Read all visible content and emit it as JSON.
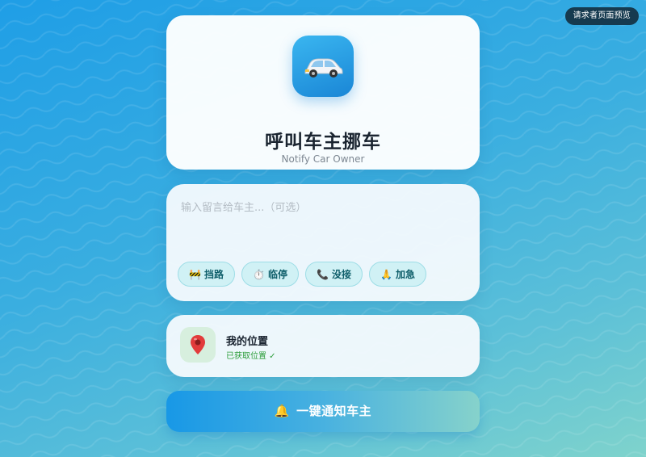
{
  "preview_button": {
    "label": "请求者页面预览"
  },
  "header": {
    "app_icon": "car-icon",
    "title": "呼叫车主挪车",
    "subtitle": "Notify Car Owner"
  },
  "message": {
    "placeholder": "输入留言给车主...（可选）",
    "value": "",
    "quick_chips": [
      {
        "icon": "roadblock-icon",
        "glyph": "🚧",
        "label": "挡路"
      },
      {
        "icon": "stopwatch-icon",
        "glyph": "⏱️",
        "label": "临停"
      },
      {
        "icon": "phone-icon",
        "glyph": "📞",
        "label": "没接"
      },
      {
        "icon": "pray-icon",
        "glyph": "🙏",
        "label": "加急"
      }
    ]
  },
  "location": {
    "icon": "map-pin-icon",
    "title": "我的位置",
    "status": "已获取位置 ✓"
  },
  "notify_button": {
    "icon": "bell-icon",
    "glyph": "🔔",
    "label": "一键通知车主"
  },
  "colors": {
    "accent": "#1a8fe0",
    "chip_bg": "#d0f1f5",
    "success": "#2c9d3a"
  }
}
